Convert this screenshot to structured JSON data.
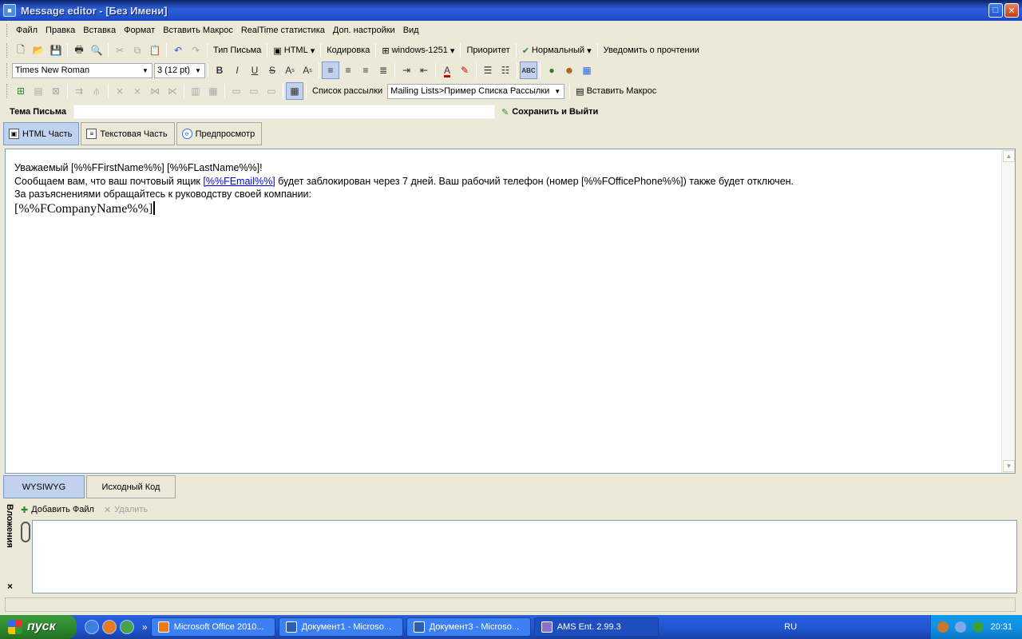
{
  "window": {
    "title": "Message editor - [Без Имени]"
  },
  "menu": [
    "Файл",
    "Правка",
    "Вставка",
    "Формат",
    "Вставить Макрос",
    "RealTime статистика",
    "Доп. настройки",
    "Вид"
  ],
  "toolbar1": {
    "mail_type_label": "Тип Письма",
    "format_label": "HTML",
    "encoding_label": "Кодировка",
    "encoding_value": "windows-1251",
    "priority_label": "Приоритет",
    "priority_value": "Нормальный",
    "read_receipt_label": "Уведомить о прочтении"
  },
  "toolbar2": {
    "font_name": "Times New Roman",
    "font_size": "3  (12 pt)"
  },
  "toolbar3": {
    "mailing_list_label": "Список рассылки",
    "mailing_list_value": "Mailing Lists>Пример Списка Рассылки",
    "insert_macro_label": "Вставить Макрос"
  },
  "subject": {
    "label": "Тема Письма",
    "value": "",
    "save_label": "Сохранить и Выйти"
  },
  "tabs_top": [
    "HTML Часть",
    "Текстовая Часть",
    "Предпросмотр"
  ],
  "editor": {
    "line1": "Уважаемый [%%FFirstName%%] [%%FLastName%%]!",
    "line2_pre": "Сообщаем вам, что ваш почтовый ящик ",
    "line2_link": "[%%FEmail%%]",
    "line2_post": " будет заблокирован через 7 дней. Ваш рабочий телефон (номер [%%FOfficePhone%%]) также будет отключен.",
    "line3": "За разъяснениями обращайтесь к руководству своей компании:",
    "line4": "[%%FCompanyName%%]"
  },
  "tabs_bottom": [
    "WYSIWYG",
    "Исходный Код"
  ],
  "attachments": {
    "side_label": "Вложения",
    "add_label": "Добавить Файл",
    "delete_label": "Удалить",
    "close_label": "×"
  },
  "taskbar": {
    "start_label": "пуск",
    "tasks": [
      "Microsoft Office 2010...",
      "Документ1 - Microso...",
      "Документ3 - Microso...",
      "AMS Ent. 2.99.3"
    ],
    "language": "RU",
    "clock": "20:31"
  },
  "colors": {
    "titlebar": "#2a5bd8",
    "active_tab": "#c1d2ee",
    "link": "#0000ee",
    "chrome": "#ece9d8"
  }
}
